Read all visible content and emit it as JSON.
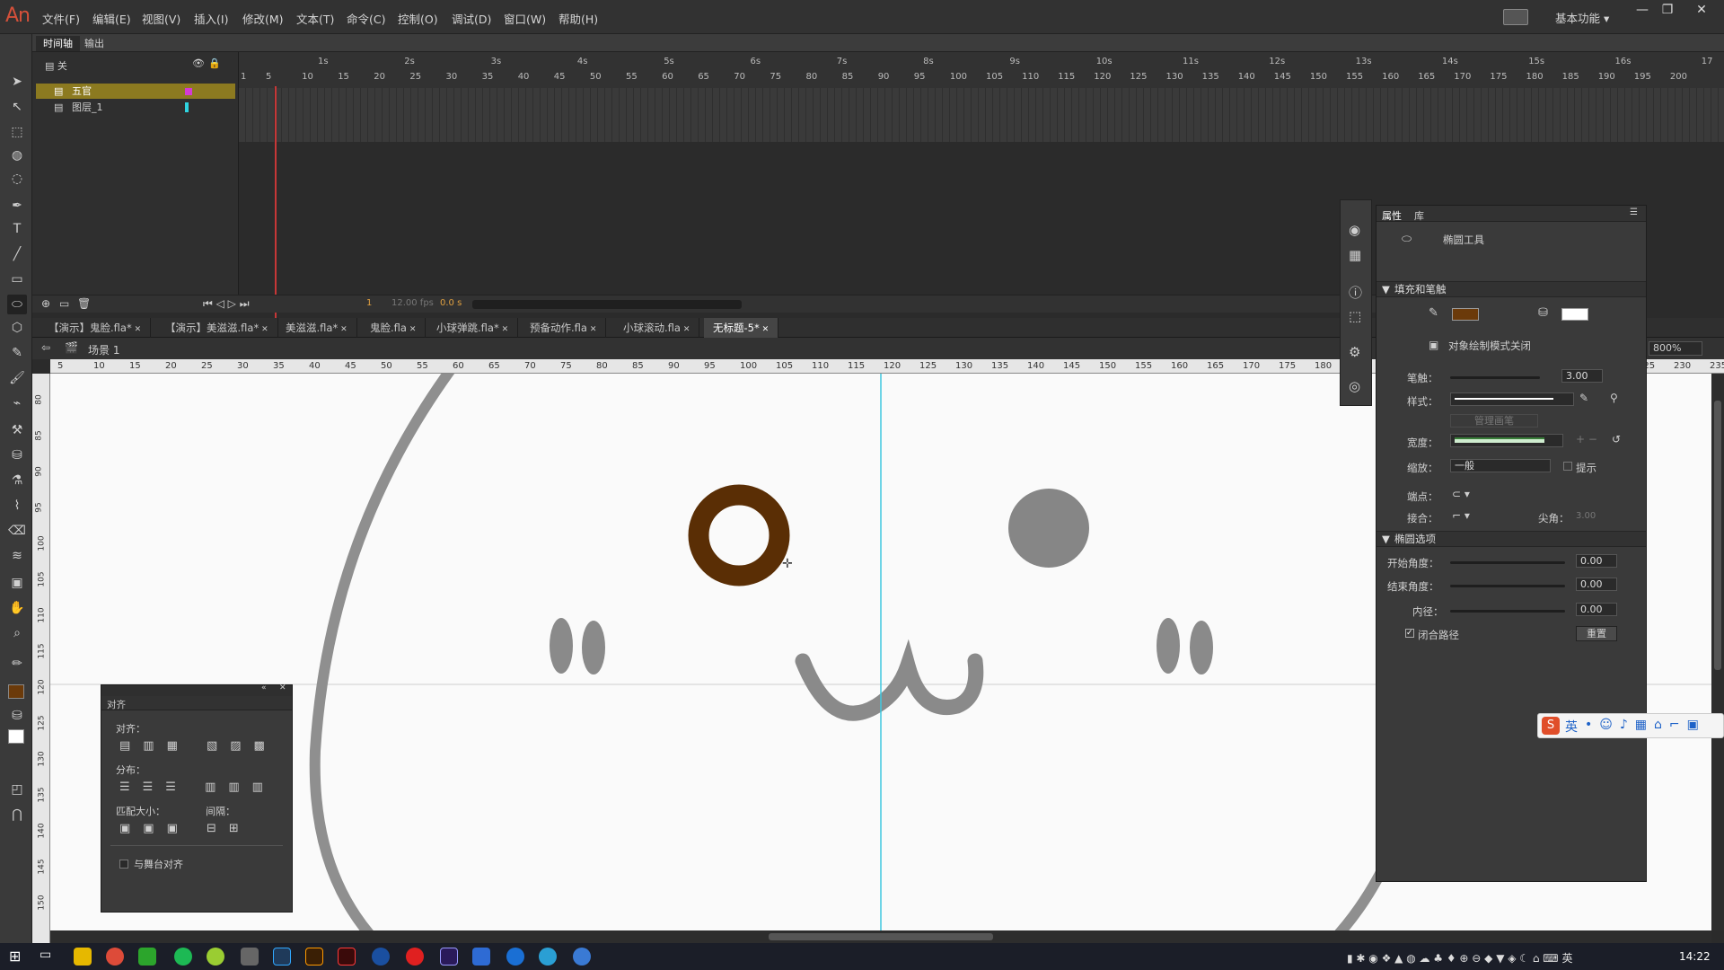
{
  "app": {
    "logo": "An"
  },
  "menu": [
    "文件(F)",
    "编辑(E)",
    "视图(V)",
    "插入(I)",
    "修改(M)",
    "文本(T)",
    "命令(C)",
    "控制(O)",
    "调试(D)",
    "窗口(W)",
    "帮助(H)"
  ],
  "workspace": {
    "label": "基本功能"
  },
  "timeline": {
    "tabs": [
      "时间轴",
      "输出"
    ],
    "layers": [
      {
        "name": "五官"
      },
      {
        "name": "图层_1"
      }
    ],
    "layers_header": "关",
    "ruler_seconds": [
      "1s",
      "2s",
      "3s",
      "4s",
      "5s",
      "6s",
      "7s",
      "8s",
      "9s",
      "10s",
      "11s",
      "12s",
      "13s",
      "14s",
      "15s",
      "16s",
      "17"
    ],
    "ruler_frames": [
      "1",
      "5",
      "10",
      "15",
      "20",
      "25",
      "30",
      "35",
      "40",
      "45",
      "50",
      "55",
      "60",
      "65",
      "70",
      "75",
      "80",
      "85",
      "90",
      "95",
      "100",
      "105",
      "110",
      "115",
      "120",
      "125",
      "130",
      "135",
      "140",
      "145",
      "150",
      "155",
      "160",
      "165",
      "170",
      "175",
      "180",
      "185",
      "190",
      "195",
      "200"
    ],
    "current_frame": "1",
    "fps": "12.00 fps",
    "time": "0.0 s"
  },
  "doc_tabs": [
    "【演示】鬼脸.fla*",
    "【演示】美滋滋.fla*",
    "美滋滋.fla*",
    "鬼脸.fla",
    "小球弹跳.fla*",
    "预备动作.fla",
    "小球滚动.fla",
    "无标题-5*"
  ],
  "active_doc": "无标题-5*",
  "scene": {
    "label": "场景 1",
    "zoom": "800%"
  },
  "ruler_top": [
    "5",
    "10",
    "15",
    "20",
    "25",
    "30",
    "35",
    "40",
    "45",
    "50",
    "55",
    "60",
    "65",
    "70",
    "75",
    "80",
    "85",
    "90",
    "95",
    "100",
    "105",
    "110",
    "115",
    "120",
    "125",
    "130",
    "135",
    "140",
    "145",
    "150",
    "155",
    "160",
    "165",
    "170",
    "175",
    "180",
    "185",
    "190",
    "195",
    "200",
    "205",
    "210",
    "215",
    "220",
    "225",
    "230",
    "235"
  ],
  "ruler_left": [
    "80",
    "85",
    "90",
    "95",
    "100",
    "105",
    "110",
    "115",
    "120",
    "125",
    "130",
    "135",
    "140",
    "145",
    "150"
  ],
  "align_panel": {
    "title": "对齐",
    "align_label": "对齐：",
    "distribute_label": "分布：",
    "match_size_label": "匹配大小：",
    "spacing_label": "间隔：",
    "stage_align": "与舞台对齐"
  },
  "properties": {
    "tabs": [
      "属性",
      "库"
    ],
    "tool_name": "椭圆工具",
    "fill_stroke_section": "填充和笔触",
    "stroke_color": "#6b3a0a",
    "fill_color": "#ffffff",
    "object_draw_mode": "对象绘制模式关闭",
    "stroke_label": "笔触：",
    "stroke_value": "3.00",
    "style_label": "样式：",
    "manage_brush": "管理画笔",
    "width_label": "宽度：",
    "scale_label": "缩放：",
    "scale_value": "一般",
    "hint_label": "提示",
    "cap_label": "端点：",
    "join_label": "接合：",
    "miter_label": "尖角：",
    "miter_value": "3.00",
    "oval_section": "椭圆选项",
    "start_angle_label": "开始角度：",
    "start_angle_value": "0.00",
    "end_angle_label": "结束角度：",
    "end_angle_value": "0.00",
    "inner_radius_label": "内径：",
    "inner_radius_value": "0.00",
    "close_path_label": "闭合路径",
    "reset_button": "重置"
  },
  "ime": {
    "label": "英"
  },
  "taskbar": {
    "clock": "14:22",
    "lang": "英"
  },
  "colors": {
    "accent_ring": "#5a2e05",
    "guide": "#3fc8e0",
    "playhead": "#c73737",
    "face": "#808080"
  }
}
